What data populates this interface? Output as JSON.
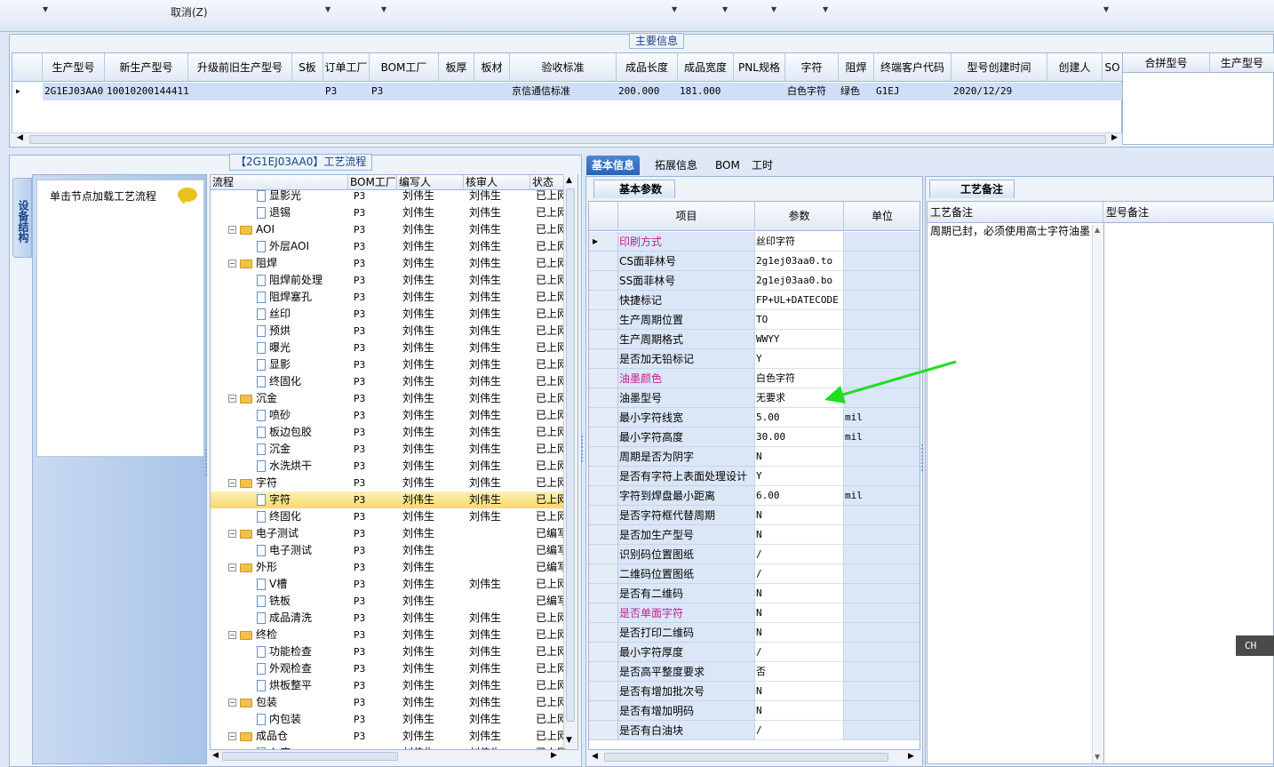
{
  "toolbar": {
    "cancel_label": "取消(Z)"
  },
  "main_info": {
    "group_title": "主要信息",
    "columns": [
      "生产型号",
      "新生产型号",
      "升级前旧生产型号",
      "S板",
      "订单工厂",
      "BOM工厂",
      "板厚",
      "板材",
      "验收标准",
      "成品长度",
      "成品宽度",
      "PNL规格",
      "字符",
      "阻焊",
      "终端客户代码",
      "型号创建时间",
      "创建人",
      "SO"
    ],
    "row": [
      "2G1EJ03AA0",
      "10010200144411",
      "",
      "",
      "P3",
      "P3",
      "",
      "",
      "京信通信标准",
      "200.000",
      "181.000",
      "",
      "白色字符",
      "绿色",
      "G1EJ",
      "2020/12/29",
      "",
      ""
    ],
    "merge_columns": [
      "合拼型号",
      "生产型号"
    ]
  },
  "process": {
    "title": "【2G1EJ03AA0】工艺流程",
    "side_tab": "设备结构",
    "node_hint": "单击节点加载工艺流程",
    "columns": [
      "流程",
      "BOM工厂",
      "编写人",
      "核审人",
      "状态"
    ],
    "rows": [
      {
        "level": 2,
        "type": "doc",
        "name": "显影光",
        "bom": "P3",
        "writer": "刘伟生",
        "reviewer": "刘伟生",
        "status": "已上网"
      },
      {
        "level": 2,
        "type": "doc",
        "name": "退锡",
        "bom": "P3",
        "writer": "刘伟生",
        "reviewer": "刘伟生",
        "status": "已上网"
      },
      {
        "level": 1,
        "type": "folder",
        "name": "AOI",
        "bom": "P3",
        "writer": "刘伟生",
        "reviewer": "刘伟生",
        "status": "已上网"
      },
      {
        "level": 2,
        "type": "doc",
        "name": "外层AOI",
        "bom": "P3",
        "writer": "刘伟生",
        "reviewer": "刘伟生",
        "status": "已上网"
      },
      {
        "level": 1,
        "type": "folder",
        "name": "阻焊",
        "bom": "P3",
        "writer": "刘伟生",
        "reviewer": "刘伟生",
        "status": "已上网"
      },
      {
        "level": 2,
        "type": "doc",
        "name": "阻焊前处理",
        "bom": "P3",
        "writer": "刘伟生",
        "reviewer": "刘伟生",
        "status": "已上网"
      },
      {
        "level": 2,
        "type": "doc",
        "name": "阻焊塞孔",
        "bom": "P3",
        "writer": "刘伟生",
        "reviewer": "刘伟生",
        "status": "已上网"
      },
      {
        "level": 2,
        "type": "doc",
        "name": "丝印",
        "bom": "P3",
        "writer": "刘伟生",
        "reviewer": "刘伟生",
        "status": "已上网"
      },
      {
        "level": 2,
        "type": "doc",
        "name": "预烘",
        "bom": "P3",
        "writer": "刘伟生",
        "reviewer": "刘伟生",
        "status": "已上网"
      },
      {
        "level": 2,
        "type": "doc",
        "name": "曝光",
        "bom": "P3",
        "writer": "刘伟生",
        "reviewer": "刘伟生",
        "status": "已上网"
      },
      {
        "level": 2,
        "type": "doc",
        "name": "显影",
        "bom": "P3",
        "writer": "刘伟生",
        "reviewer": "刘伟生",
        "status": "已上网"
      },
      {
        "level": 2,
        "type": "doc",
        "name": "终固化",
        "bom": "P3",
        "writer": "刘伟生",
        "reviewer": "刘伟生",
        "status": "已上网"
      },
      {
        "level": 1,
        "type": "folder",
        "name": "沉金",
        "bom": "P3",
        "writer": "刘伟生",
        "reviewer": "刘伟生",
        "status": "已上网"
      },
      {
        "level": 2,
        "type": "doc",
        "name": "喷砂",
        "bom": "P3",
        "writer": "刘伟生",
        "reviewer": "刘伟生",
        "status": "已上网"
      },
      {
        "level": 2,
        "type": "doc",
        "name": "板边包胶",
        "bom": "P3",
        "writer": "刘伟生",
        "reviewer": "刘伟生",
        "status": "已上网"
      },
      {
        "level": 2,
        "type": "doc",
        "name": "沉金",
        "bom": "P3",
        "writer": "刘伟生",
        "reviewer": "刘伟生",
        "status": "已上网"
      },
      {
        "level": 2,
        "type": "doc",
        "name": "水洗烘干",
        "bom": "P3",
        "writer": "刘伟生",
        "reviewer": "刘伟生",
        "status": "已上网"
      },
      {
        "level": 1,
        "type": "folder",
        "name": "字符",
        "bom": "P3",
        "writer": "刘伟生",
        "reviewer": "刘伟生",
        "status": "已上网"
      },
      {
        "level": 2,
        "type": "doc",
        "name": "字符",
        "bom": "P3",
        "writer": "刘伟生",
        "reviewer": "刘伟生",
        "status": "已上网",
        "selected": true
      },
      {
        "level": 2,
        "type": "doc",
        "name": "终固化",
        "bom": "P3",
        "writer": "刘伟生",
        "reviewer": "刘伟生",
        "status": "已上网"
      },
      {
        "level": 1,
        "type": "folder",
        "name": "电子测试",
        "bom": "P3",
        "writer": "刘伟生",
        "reviewer": "",
        "status": "已编写"
      },
      {
        "level": 2,
        "type": "doc",
        "name": "电子测试",
        "bom": "P3",
        "writer": "刘伟生",
        "reviewer": "",
        "status": "已编写"
      },
      {
        "level": 1,
        "type": "folder",
        "name": "外形",
        "bom": "P3",
        "writer": "刘伟生",
        "reviewer": "",
        "status": "已编写"
      },
      {
        "level": 2,
        "type": "doc",
        "name": "V槽",
        "bom": "P3",
        "writer": "刘伟生",
        "reviewer": "刘伟生",
        "status": "已上网"
      },
      {
        "level": 2,
        "type": "doc",
        "name": "铣板",
        "bom": "P3",
        "writer": "刘伟生",
        "reviewer": "",
        "status": "已编写"
      },
      {
        "level": 2,
        "type": "doc",
        "name": "成品清洗",
        "bom": "P3",
        "writer": "刘伟生",
        "reviewer": "刘伟生",
        "status": "已上网"
      },
      {
        "level": 1,
        "type": "folder",
        "name": "终检",
        "bom": "P3",
        "writer": "刘伟生",
        "reviewer": "刘伟生",
        "status": "已上网"
      },
      {
        "level": 2,
        "type": "doc",
        "name": "功能检查",
        "bom": "P3",
        "writer": "刘伟生",
        "reviewer": "刘伟生",
        "status": "已上网"
      },
      {
        "level": 2,
        "type": "doc",
        "name": "外观检查",
        "bom": "P3",
        "writer": "刘伟生",
        "reviewer": "刘伟生",
        "status": "已上网"
      },
      {
        "level": 2,
        "type": "doc",
        "name": "烘板整平",
        "bom": "P3",
        "writer": "刘伟生",
        "reviewer": "刘伟生",
        "status": "已上网"
      },
      {
        "level": 1,
        "type": "folder",
        "name": "包装",
        "bom": "P3",
        "writer": "刘伟生",
        "reviewer": "刘伟生",
        "status": "已上网"
      },
      {
        "level": 2,
        "type": "doc",
        "name": "内包装",
        "bom": "P3",
        "writer": "刘伟生",
        "reviewer": "刘伟生",
        "status": "已上网"
      },
      {
        "level": 1,
        "type": "folder",
        "name": "成品仓",
        "bom": "P3",
        "writer": "刘伟生",
        "reviewer": "刘伟生",
        "status": "已上网"
      },
      {
        "level": 2,
        "type": "doc",
        "name": "入库",
        "bom": "P3",
        "writer": "刘伟生",
        "reviewer": "刘伟生",
        "status": "已上网"
      }
    ]
  },
  "tabs": [
    "基本信息",
    "拓展信息",
    "BOM",
    "工时"
  ],
  "basic_params": {
    "tab": "基本参数",
    "columns": [
      "项目",
      "参数",
      "单位"
    ],
    "rows": [
      {
        "item": "印刷方式",
        "value": "丝印字符",
        "unit": "",
        "hl": true
      },
      {
        "item": "CS面菲林号",
        "value": "2g1ej03aa0.to",
        "unit": ""
      },
      {
        "item": "SS面菲林号",
        "value": "2g1ej03aa0.bo",
        "unit": ""
      },
      {
        "item": "快捷标记",
        "value": "FP+UL+DATECODE",
        "unit": ""
      },
      {
        "item": "生产周期位置",
        "value": "TO",
        "unit": ""
      },
      {
        "item": "生产周期格式",
        "value": "WWYY",
        "unit": ""
      },
      {
        "item": "是否加无铅标记",
        "value": "Y",
        "unit": ""
      },
      {
        "item": "油墨颜色",
        "value": "白色字符",
        "unit": "",
        "hl": true
      },
      {
        "item": "油墨型号",
        "value": "无要求",
        "unit": ""
      },
      {
        "item": "最小字符线宽",
        "value": "5.00",
        "unit": "mil"
      },
      {
        "item": "最小字符高度",
        "value": "30.00",
        "unit": "mil"
      },
      {
        "item": "周期是否为阴字",
        "value": "N",
        "unit": ""
      },
      {
        "item": "是否有字符上表面处理设计",
        "value": "Y",
        "unit": ""
      },
      {
        "item": "字符到焊盘最小距离",
        "value": "6.00",
        "unit": "mil"
      },
      {
        "item": "是否字符框代替周期",
        "value": "N",
        "unit": ""
      },
      {
        "item": "是否加生产型号",
        "value": "N",
        "unit": ""
      },
      {
        "item": "识别码位置图纸",
        "value": "/",
        "unit": ""
      },
      {
        "item": "二维码位置图纸",
        "value": "/",
        "unit": ""
      },
      {
        "item": "是否有二维码",
        "value": "N",
        "unit": ""
      },
      {
        "item": "是否单面字符",
        "value": "N",
        "unit": "",
        "hl": true
      },
      {
        "item": "是否打印二维码",
        "value": "N",
        "unit": ""
      },
      {
        "item": "最小字符厚度",
        "value": "/",
        "unit": ""
      },
      {
        "item": "是否高平整度要求",
        "value": "否",
        "unit": ""
      },
      {
        "item": "是否有增加批次号",
        "value": "N",
        "unit": ""
      },
      {
        "item": "是否有增加明码",
        "value": "N",
        "unit": ""
      },
      {
        "item": "是否有白油块",
        "value": "/",
        "unit": ""
      }
    ]
  },
  "notes": {
    "tab": "工艺备注",
    "col1": "工艺备注",
    "col2": "型号备注",
    "text": "周期已封，必须使用高士字符油墨"
  },
  "ime": "CH",
  "colors": {
    "accent": "#2a61b3",
    "highlight": "#c0208f",
    "arrow": "#22dd22"
  }
}
